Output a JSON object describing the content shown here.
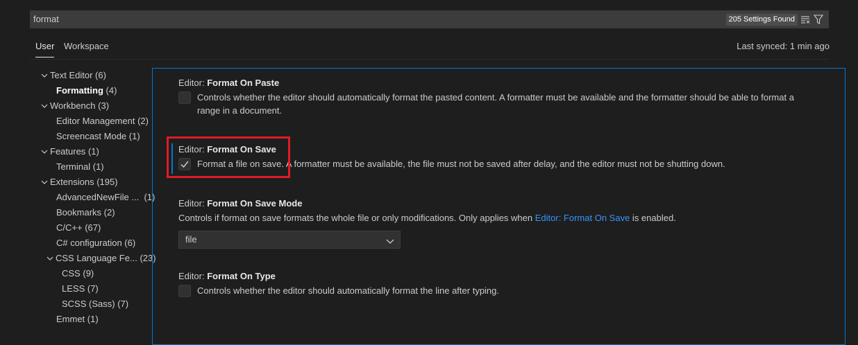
{
  "search": {
    "query": "format",
    "results_count": "205 Settings Found"
  },
  "tabs": [
    {
      "label": "User"
    },
    {
      "label": "Workspace"
    }
  ],
  "last_synced": "Last synced: 1 min ago",
  "toc": [
    {
      "label": "Text Editor",
      "count": "(6)"
    },
    {
      "label": "Formatting",
      "count": "(4)"
    },
    {
      "label": "Workbench",
      "count": "(3)"
    },
    {
      "label": "Editor Management",
      "count": "(2)"
    },
    {
      "label": "Screencast Mode",
      "count": "(1)"
    },
    {
      "label": "Features",
      "count": "(1)"
    },
    {
      "label": "Terminal",
      "count": "(1)"
    },
    {
      "label": "Extensions",
      "count": "(195)"
    },
    {
      "label": "AdvancedNewFile ...",
      "count": "(1)"
    },
    {
      "label": "Bookmarks",
      "count": "(2)"
    },
    {
      "label": "C/C++",
      "count": "(67)"
    },
    {
      "label": "C# configuration",
      "count": "(6)"
    },
    {
      "label": "CSS Language Fe...",
      "count": "(23)"
    },
    {
      "label": "CSS",
      "count": "(9)"
    },
    {
      "label": "LESS",
      "count": "(7)"
    },
    {
      "label": "SCSS (Sass)",
      "count": "(7)"
    },
    {
      "label": "Emmet",
      "count": "(1)"
    }
  ],
  "settings": {
    "format_on_paste": {
      "category": "Editor: ",
      "name": "Format On Paste",
      "description_line1": "Controls whether the editor should automatically format the pasted content. A formatter must be available and the formatter should be able to format a",
      "description_line2": "range in a document.",
      "checked": false
    },
    "format_on_save": {
      "category": "Editor: ",
      "name": "Format On Save",
      "description": "Format a file on save. A formatter must be available, the file must not be saved after delay, and the editor must not be shutting down.",
      "checked": true
    },
    "format_on_save_mode": {
      "category": "Editor: ",
      "name": "Format On Save Mode",
      "description_prefix": "Controls if format on save formats the whole file or only modifications. Only applies when ",
      "description_link": "Editor: Format On Save",
      "description_suffix": " is enabled.",
      "value": "file"
    },
    "format_on_type": {
      "category": "Editor: ",
      "name": "Format On Type",
      "description": "Controls whether the editor should automatically format the line after typing.",
      "checked": false
    }
  },
  "colors": {
    "accent": "#0078d4",
    "link": "#3794ff",
    "highlight": "#e01b24",
    "background": "#1e1e1e"
  },
  "icons": {
    "clear": "clear-filter-icon",
    "filter": "filter-icon",
    "chevron": "chevron-icon",
    "check": "check-icon"
  }
}
